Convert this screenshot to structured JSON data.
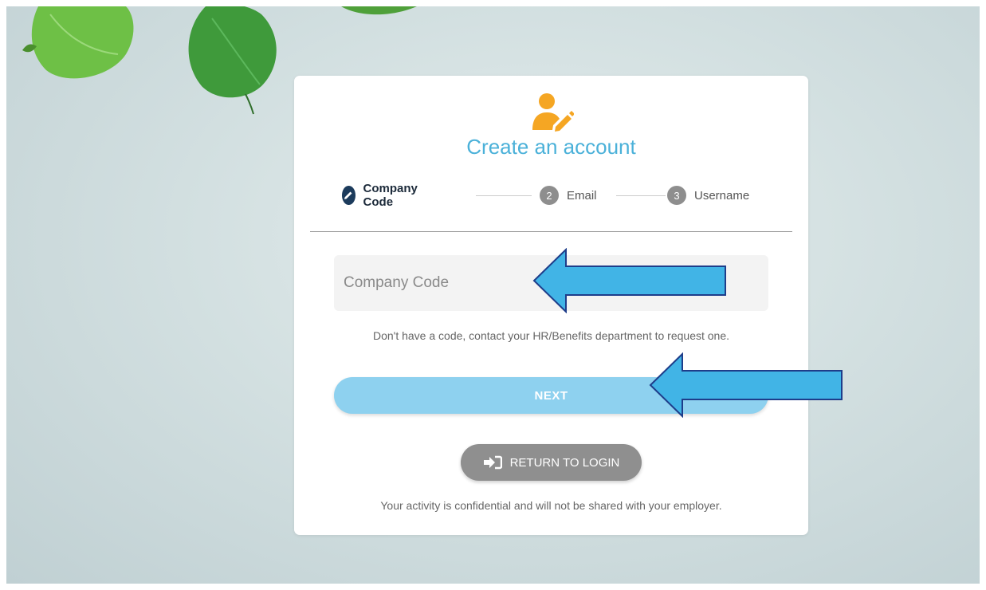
{
  "header": {
    "title": "Create an account",
    "icon": "user-edit-icon"
  },
  "stepper": {
    "steps": [
      {
        "number": "",
        "label": "Company Code",
        "state": "active",
        "icon": "pencil-icon"
      },
      {
        "number": "2",
        "label": "Email",
        "state": "inactive"
      },
      {
        "number": "3",
        "label": "Username",
        "state": "inactive"
      }
    ]
  },
  "form": {
    "company_code_placeholder": "Company Code",
    "company_code_value": "",
    "hint": "Don't have a code, contact your HR/Benefits department to request one.",
    "next_label": "NEXT",
    "return_label": "RETURN TO LOGIN",
    "return_icon": "sign-in-icon"
  },
  "footer": {
    "confidential": "Your activity is confidential and will not be shared with your employer."
  },
  "colors": {
    "title": "#4bb1d9",
    "active_step": "#1c3b5c",
    "inactive_step": "#8e8e8e",
    "next_button": "#8ed1ef",
    "return_button": "#8f8f8f",
    "user_icon": "#f5a623",
    "annotation_arrow": "#41b4e6"
  }
}
